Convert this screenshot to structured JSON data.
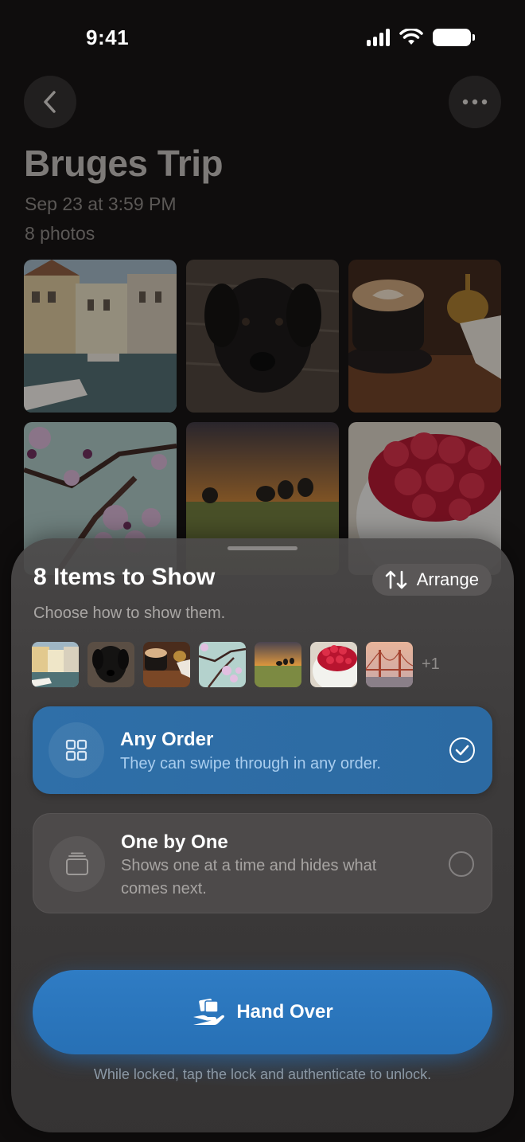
{
  "status_bar": {
    "time": "9:41"
  },
  "header": {
    "title": "Bruges Trip",
    "date": "Sep 23 at 3:59 PM",
    "photo_count": "8 photos"
  },
  "grid_photos": [
    "canal-houses",
    "black-dog",
    "latte-cup",
    "cherry-blossom",
    "sunset-field",
    "raspberries"
  ],
  "sheet": {
    "title": "8 Items to Show",
    "subtitle": "Choose how to show them.",
    "arrange_label": "Arrange",
    "more_count": "+1",
    "thumbnails": [
      "canal-houses",
      "black-dog",
      "latte-cup",
      "cherry-blossom",
      "sunset-field",
      "raspberries",
      "golden-gate-bridge"
    ],
    "options": [
      {
        "title": "Any Order",
        "description": "They can swipe through in any order.",
        "selected": true
      },
      {
        "title": "One by One",
        "description": "Shows one at a time and hides what comes next.",
        "selected": false
      }
    ],
    "primary_button": "Hand Over",
    "footnote": "While locked, tap the lock and authenticate to unlock."
  },
  "colors": {
    "accent": "#2f7cc4",
    "selected_option": "#2f6fa8",
    "background": "#0f0d0d"
  }
}
